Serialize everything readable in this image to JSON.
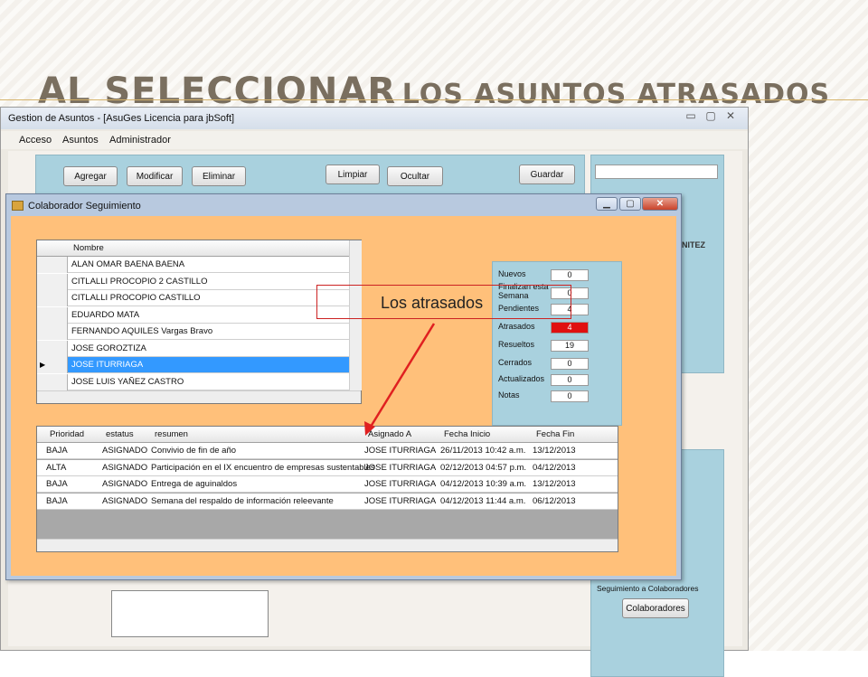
{
  "slide": {
    "title_big": "AL SELECCIONAR",
    "title_small": "LOS ASUNTOS ATRASADOS"
  },
  "main_window": {
    "title": "Gestion de Asuntos - [AsuGes    Licencia para jbSoft]",
    "menu": [
      "Acceso",
      "Asuntos",
      "Administrador"
    ],
    "buttons": {
      "agregar": "Agregar",
      "modificar": "Modificar",
      "eliminar": "Eliminar",
      "limpiar": "Limpiar",
      "ocultar": "Ocultar",
      "guardar": "Guardar"
    },
    "right_label": "NITEZ",
    "seguimiento_label": "Seguimiento a Colaboradores",
    "colaboradores_button": "Colaboradores"
  },
  "dialog": {
    "title": "Colaborador Seguimiento",
    "names_header": "Nombre",
    "names": [
      "ALAN OMAR BAENA BAENA",
      "CITLALLI PROCOPIO 2 CASTILLO",
      "CITLALLI PROCOPIO CASTILLO",
      "EDUARDO MATA",
      "FERNANDO AQUILES Vargas Bravo",
      "JOSE GOROZTIZA",
      "JOSE ITURRIAGA",
      "JOSE LUIS YAÑEZ CASTRO"
    ],
    "selected_index": 6,
    "stats": [
      {
        "label": "Nuevos",
        "value": "0"
      },
      {
        "label": "Finalizan esta Semana",
        "value": "0"
      },
      {
        "label": "Pendientes",
        "value": "4"
      },
      {
        "label": "Atrasados",
        "value": "4"
      },
      {
        "label": "Resueltos",
        "value": "19"
      },
      {
        "label": "Cerrados",
        "value": "0"
      },
      {
        "label": "Actualizados",
        "value": "0"
      },
      {
        "label": "Notas",
        "value": "0"
      }
    ],
    "tasks_columns": [
      "Prioridad",
      "estatus",
      "resumen",
      "Asignado A",
      "Fecha Inicio",
      "Fecha Fin"
    ],
    "tasks": [
      [
        "BAJA",
        "ASIGNADO",
        "Convivio de fin de año",
        "JOSE ITURRIAGA",
        "26/11/2013 10:42 a.m.",
        "13/12/2013"
      ],
      [
        "ALTA",
        "ASIGNADO",
        "Participación en el IX encuentro de empresas sustentables",
        "JOSE ITURRIAGA",
        "02/12/2013 04:57 p.m.",
        "04/12/2013"
      ],
      [
        "BAJA",
        "ASIGNADO",
        "Entrega de aguinaldos",
        "JOSE ITURRIAGA",
        "04/12/2013 10:39 a.m.",
        "13/12/2013"
      ],
      [
        "BAJA",
        "ASIGNADO",
        "Semana del respaldo de información releevante",
        "JOSE ITURRIAGA",
        "04/12/2013 11:44 a.m.",
        "06/12/2013"
      ]
    ]
  },
  "annotation": {
    "text": "Los atrasados",
    "color": "#e02020"
  },
  "colors": {
    "dialog_body": "#ffc07a",
    "panel_blue": "#a9d1de",
    "selection": "#3399ff",
    "title_text": "#7a6f5f"
  }
}
